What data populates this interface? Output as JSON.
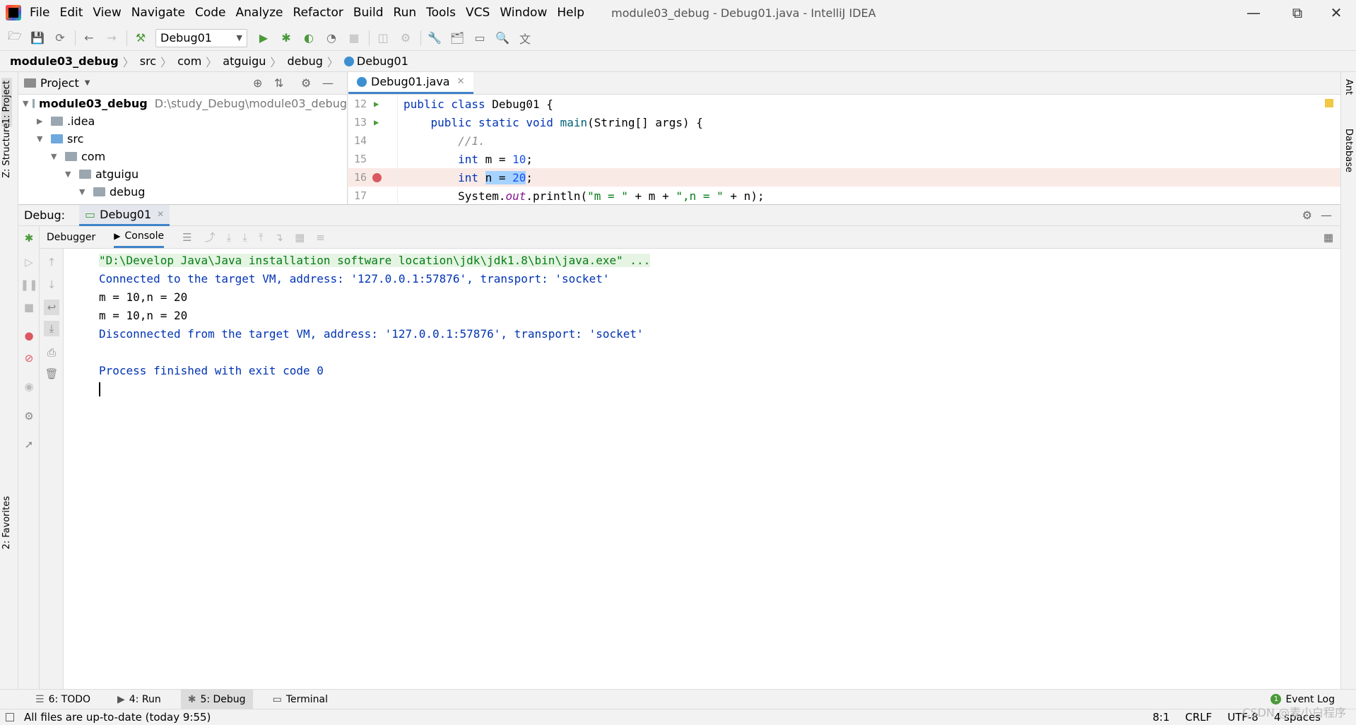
{
  "menu": [
    "File",
    "Edit",
    "View",
    "Navigate",
    "Code",
    "Analyze",
    "Refactor",
    "Build",
    "Run",
    "Tools",
    "VCS",
    "Window",
    "Help"
  ],
  "window_title": "module03_debug - Debug01.java - IntelliJ IDEA",
  "toolbar": {
    "run_config": "Debug01"
  },
  "breadcrumb": [
    "module03_debug",
    "src",
    "com",
    "atguigu",
    "debug",
    "Debug01"
  ],
  "left_tabs": {
    "project": "1: Project",
    "structure": "Z: Structure",
    "favorites": "2: Favorites"
  },
  "right_tabs": {
    "ant": "Ant",
    "database": "Database"
  },
  "project": {
    "header": "Project",
    "root_name": "module03_debug",
    "root_path": "D:\\study_Debug\\module03_debug",
    "items": [
      ".idea",
      "src",
      "com",
      "atguigu",
      "debug"
    ]
  },
  "editor": {
    "tab": "Debug01.java",
    "lines": [
      {
        "num": "12",
        "text": "public class Debug01 {"
      },
      {
        "num": "13",
        "text": "    public static void main(String[] args) {"
      },
      {
        "num": "14",
        "text": "        //1."
      },
      {
        "num": "15",
        "text": "        int m = 10;"
      },
      {
        "num": "16",
        "text": "        int n = 20;"
      },
      {
        "num": "17",
        "text": "        System.out.println(\"m = \" + m + \",n = \" + n);"
      }
    ]
  },
  "debug": {
    "label": "Debug:",
    "session_tab": "Debug01",
    "debugger_tab": "Debugger",
    "console_tab": "Console"
  },
  "console_lines": [
    "\"D:\\Develop Java\\Java installation software location\\jdk\\jdk1.8\\bin\\java.exe\" ...",
    "Connected to the target VM, address: '127.0.0.1:57876', transport: 'socket'",
    "m = 10,n = 20",
    "m = 10,n = 20",
    "Disconnected from the target VM, address: '127.0.0.1:57876', transport: 'socket'",
    "",
    "Process finished with exit code 0"
  ],
  "bottom_tabs": {
    "todo": "6: TODO",
    "run": "4: Run",
    "debug": "5: Debug",
    "terminal": "Terminal",
    "event_log": "Event Log",
    "event_count": "1"
  },
  "status": {
    "message": "All files are up-to-date (today 9:55)",
    "position": "8:1",
    "line_sep": "CRLF",
    "encoding": "UTF-8",
    "indent": "4 spaces"
  },
  "watermark": "CSDN @麦小白程序"
}
